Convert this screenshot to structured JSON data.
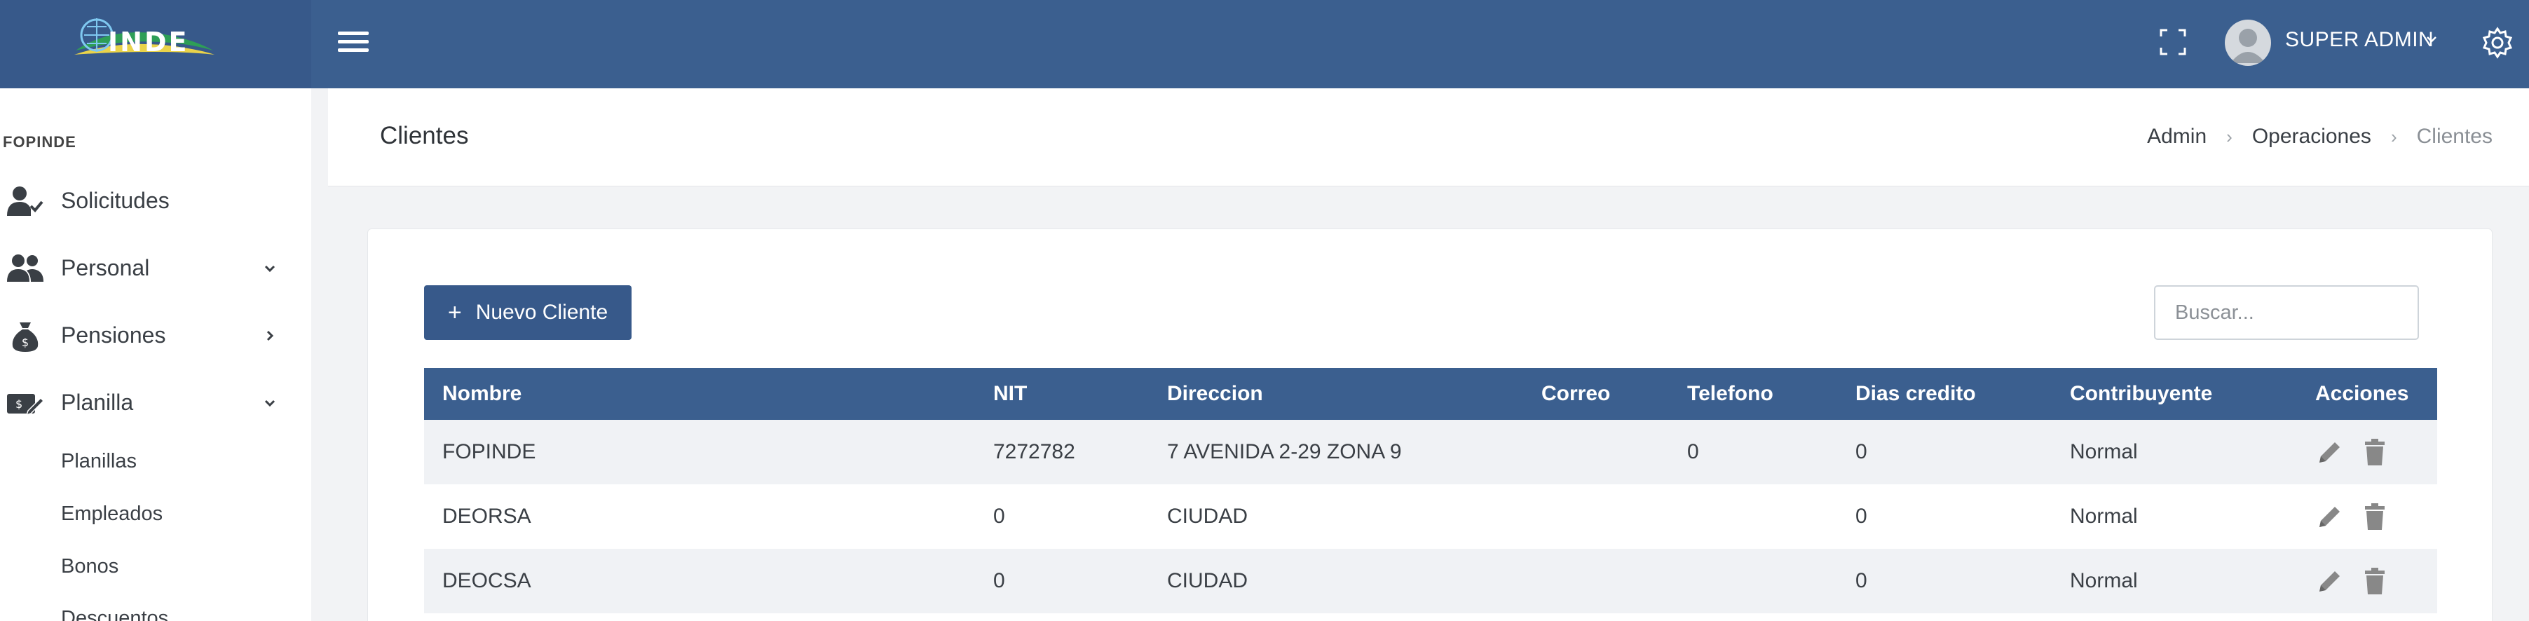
{
  "header": {
    "logo_text": "INDE",
    "user_name": "SUPER ADMIN",
    "icons": {
      "menu": "hamburger-menu-icon",
      "fullscreen": "fullscreen-icon",
      "user_dropdown": "chevron-down-icon",
      "settings": "gear-icon"
    }
  },
  "sidebar": {
    "section_title": "FOPINDE",
    "items": [
      {
        "label": "Solicitudes",
        "icon": "user-check-icon"
      },
      {
        "label": "Personal",
        "icon": "users-icon",
        "chevron": "chevron-down-icon"
      },
      {
        "label": "Pensiones",
        "icon": "money-bag-icon",
        "chevron": "chevron-right-icon"
      },
      {
        "label": "Planilla",
        "icon": "payroll-edit-icon",
        "chevron": "chevron-down-icon"
      }
    ],
    "sub_items": [
      "Planillas",
      "Empleados",
      "Bonos",
      "Descuentos"
    ]
  },
  "page": {
    "title": "Clientes",
    "breadcrumb": [
      "Admin",
      "Operaciones",
      "Clientes"
    ]
  },
  "toolbar": {
    "new_button_label": "Nuevo Cliente",
    "search_placeholder": "Buscar..."
  },
  "table": {
    "columns": [
      "Nombre",
      "NIT",
      "Direccion",
      "Correo",
      "Telefono",
      "Dias credito",
      "Contribuyente",
      "Acciones"
    ],
    "rows": [
      [
        "FOPINDE",
        "7272782",
        "7 AVENIDA 2-29 ZONA 9",
        "",
        "0",
        "0",
        "Normal"
      ],
      [
        "DEORSA",
        "0",
        "CIUDAD",
        "",
        "",
        "0",
        "Normal"
      ],
      [
        "DEOCSA",
        "0",
        "CIUDAD",
        "",
        "",
        "0",
        "Normal"
      ]
    ],
    "action_icons": [
      "edit-pencil-icon",
      "trash-icon"
    ]
  },
  "colors": {
    "primary": "#3b5f8f",
    "sidebar_bg": "#ffffff",
    "page_bg": "#f2f3f5",
    "row_alt": "#f0f2f5"
  }
}
